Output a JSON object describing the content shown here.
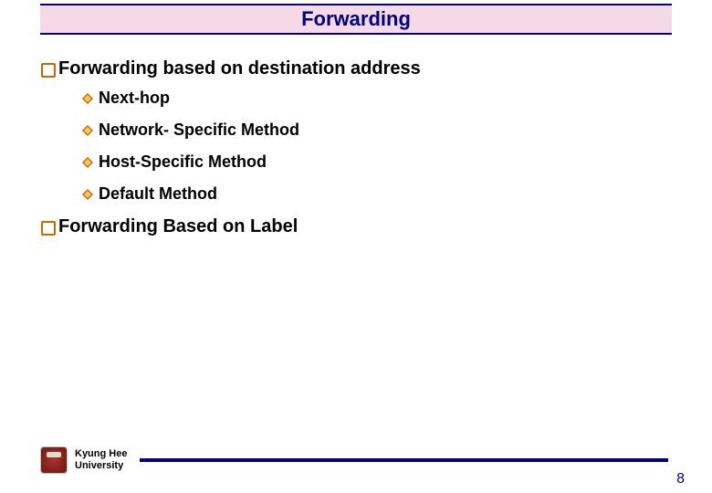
{
  "slide": {
    "title": "Forwarding",
    "sections": [
      {
        "text": "Forwarding based on destination address",
        "items": [
          {
            "text": "Next-hop"
          },
          {
            "text": "Network- Specific Method"
          },
          {
            "text": "Host-Specific Method"
          },
          {
            "text": "Default Method"
          }
        ]
      },
      {
        "text": "Forwarding Based on Label",
        "items": []
      }
    ]
  },
  "footer": {
    "university_line1": "Kyung Hee",
    "university_line2": "University",
    "page_number": "8"
  }
}
